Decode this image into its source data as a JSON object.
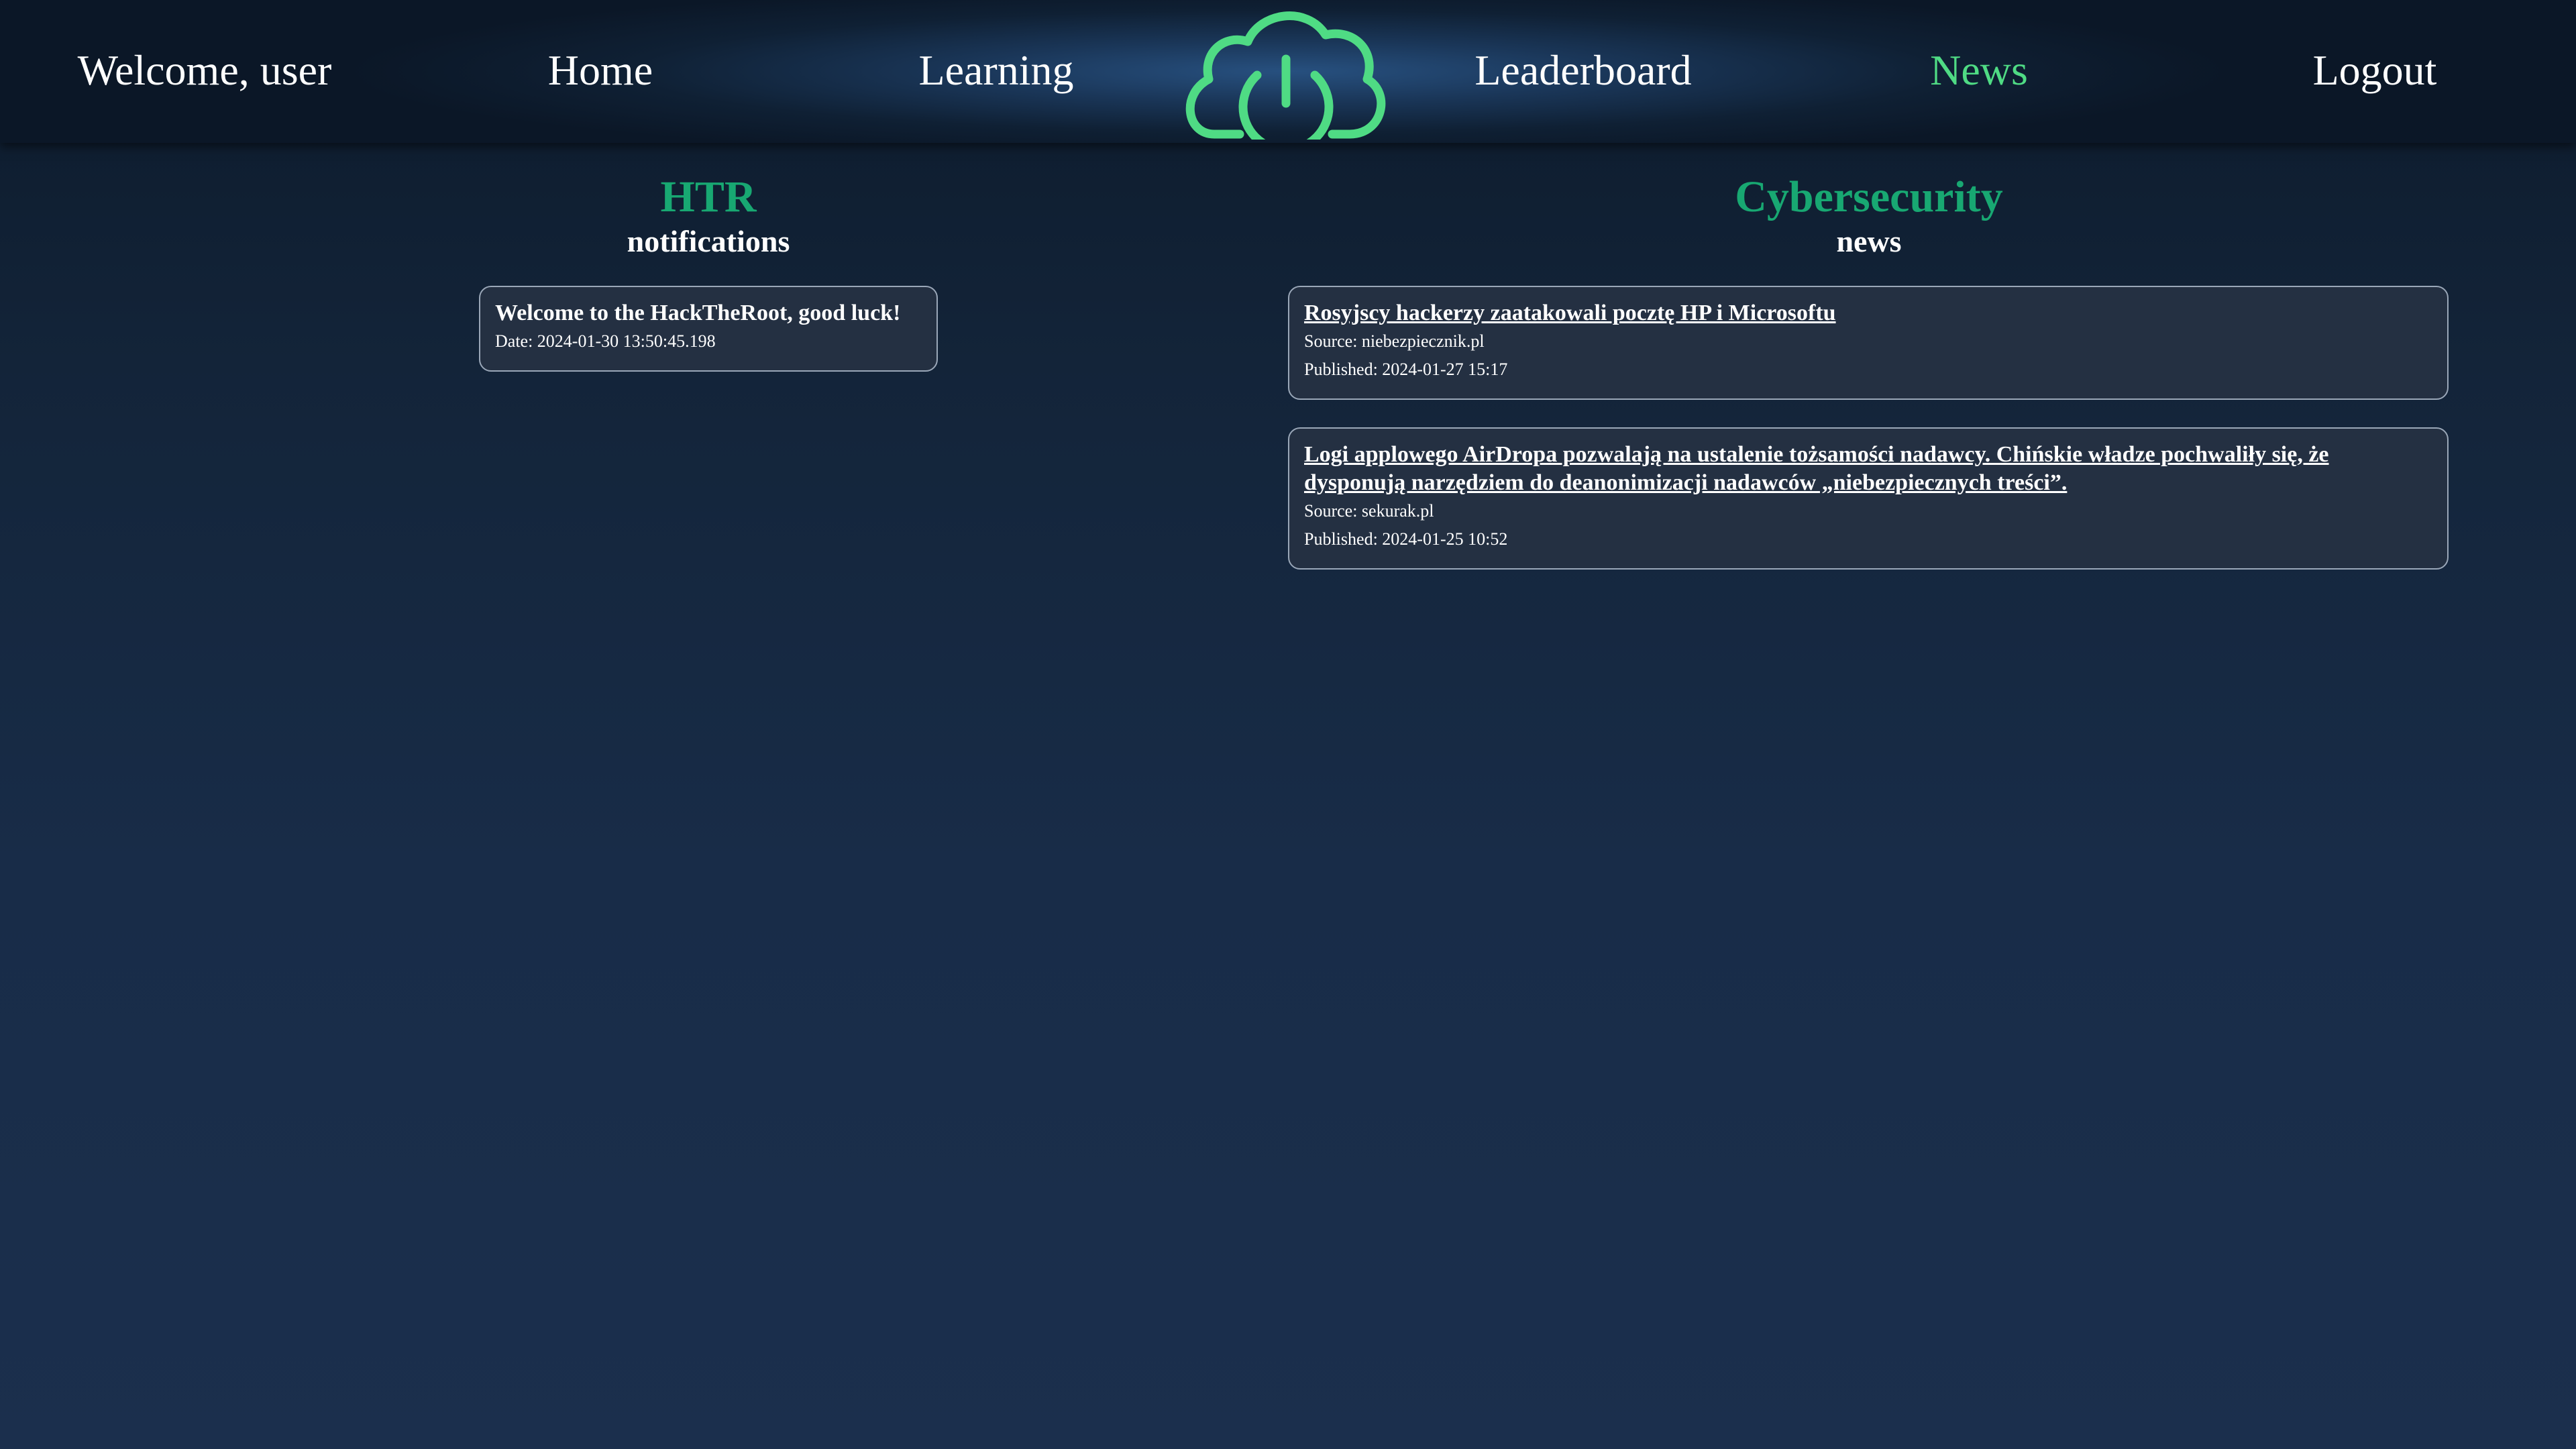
{
  "nav": {
    "welcome": "Welcome, user",
    "home": "Home",
    "learning": "Learning",
    "leaderboard": "Leaderboard",
    "news": "News",
    "logout": "Logout",
    "active": "News",
    "logo_icon": "cloud-power-icon",
    "accent_color": "#4fdb84"
  },
  "notifications": {
    "heading": "HTR",
    "subheading": "notifications",
    "items": [
      {
        "title": "Welcome to the HackTheRoot, good luck!",
        "date": "Date: 2024-01-30 13:50:45.198"
      }
    ]
  },
  "news": {
    "heading": "Cybersecurity",
    "subheading": "news",
    "items": [
      {
        "title": "Rosyjscy hackerzy zaatakowali pocztę HP i Microsoftu",
        "source": "Source: niebezpiecznik.pl",
        "published": "Published: 2024-01-27 15:17"
      },
      {
        "title": "Logi applowego AirDropa pozwalają na ustalenie tożsamości nadawcy. Chińskie władze pochwaliły się, że dysponują narzędziem do deanonimizacji nadawców „niebezpiecznych treści”.",
        "source": "Source: sekurak.pl",
        "published": "Published: 2024-01-25 10:52"
      }
    ]
  },
  "colors": {
    "heading_green": "#18a872",
    "card_bg": "#243042",
    "card_border": "#9aa7b8"
  }
}
